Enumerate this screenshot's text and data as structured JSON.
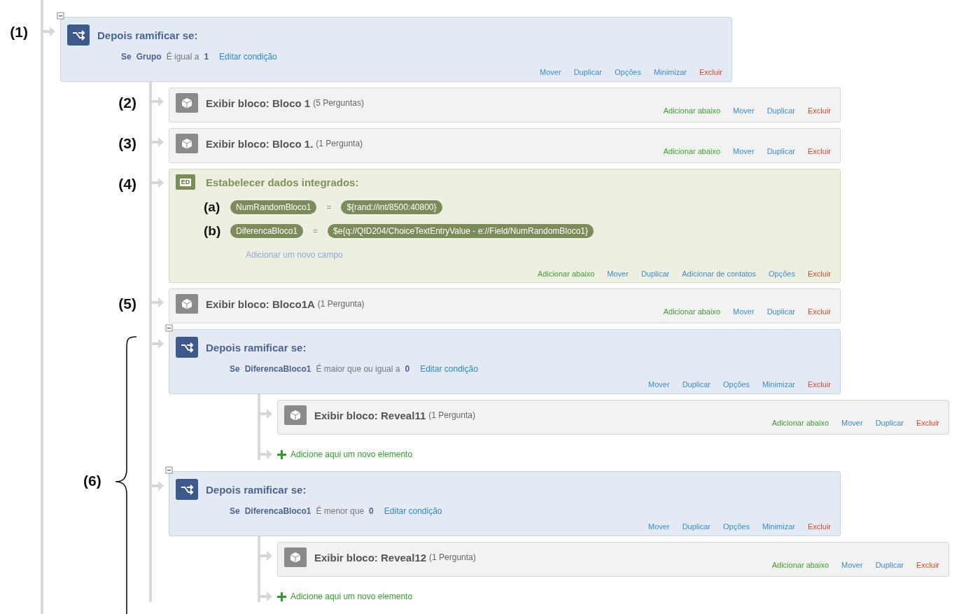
{
  "flow": [
    {
      "kind": "branch",
      "annotation": "(1)",
      "title": "Depois ramificar se:",
      "condition": {
        "prefix": "Se",
        "field": "Grupo",
        "operator": "É igual a",
        "value": "1",
        "edit": "Editar condição"
      },
      "actions": [
        {
          "label": "Mover",
          "kind": "link"
        },
        {
          "label": "Duplicar",
          "kind": "link"
        },
        {
          "label": "Opções",
          "kind": "link"
        },
        {
          "label": "Minimizar",
          "kind": "link"
        },
        {
          "label": "Excluir",
          "kind": "delete"
        }
      ],
      "children": [
        {
          "kind": "block",
          "annotation": "(2)",
          "title": "Exibir bloco: Bloco 1",
          "count": "(5 Perguntas)",
          "actions": [
            {
              "label": "Adicionar abaixo",
              "kind": "add"
            },
            {
              "label": "Mover",
              "kind": "link"
            },
            {
              "label": "Duplicar",
              "kind": "link"
            },
            {
              "label": "Excluir",
              "kind": "delete"
            }
          ]
        },
        {
          "kind": "block",
          "annotation": "(3)",
          "title": "Exibir bloco: Bloco 1.",
          "count": "(1 Pergunta)",
          "actions": [
            {
              "label": "Adicionar abaixo",
              "kind": "add"
            },
            {
              "label": "Mover",
              "kind": "link"
            },
            {
              "label": "Duplicar",
              "kind": "link"
            },
            {
              "label": "Excluir",
              "kind": "delete"
            }
          ]
        },
        {
          "kind": "embedded",
          "annotation": "(4)",
          "icon_label": "ED",
          "title": "Estabelecer dados integrados:",
          "fields": [
            {
              "annotation": "(a)",
              "name": "NumRandomBloco1",
              "equals": "=",
              "value": "${rand://int/8500:40800}"
            },
            {
              "annotation": "(b)",
              "name": "DiferencaBloco1",
              "equals": "=",
              "value": "$e{q://QID204/ChoiceTextEntryValue - e://Field/NumRandomBloco1}"
            }
          ],
          "add_field": "Adicionar um novo campo",
          "actions": [
            {
              "label": "Adicionar abaixo",
              "kind": "add"
            },
            {
              "label": "Mover",
              "kind": "link"
            },
            {
              "label": "Duplicar",
              "kind": "link"
            },
            {
              "label": "Adicionar de contatos",
              "kind": "link"
            },
            {
              "label": "Opções",
              "kind": "link"
            },
            {
              "label": "Excluir",
              "kind": "delete"
            }
          ]
        },
        {
          "kind": "block",
          "annotation": "(5)",
          "title": "Exibir bloco: Bloco1A",
          "count": "(1 Pergunta)",
          "actions": [
            {
              "label": "Adicionar abaixo",
              "kind": "add"
            },
            {
              "label": "Mover",
              "kind": "link"
            },
            {
              "label": "Duplicar",
              "kind": "link"
            },
            {
              "label": "Excluir",
              "kind": "delete"
            }
          ]
        },
        {
          "kind": "group",
          "annotation": "(6)",
          "children": [
            {
              "kind": "branch",
              "title": "Depois ramificar se:",
              "condition": {
                "prefix": "Se",
                "field": "DiferencaBloco1",
                "operator": "É maior que ou igual a",
                "value": "0",
                "edit": "Editar condição"
              },
              "actions": [
                {
                  "label": "Mover",
                  "kind": "link"
                },
                {
                  "label": "Duplicar",
                  "kind": "link"
                },
                {
                  "label": "Opções",
                  "kind": "link"
                },
                {
                  "label": "Minimizar",
                  "kind": "link"
                },
                {
                  "label": "Excluir",
                  "kind": "delete"
                }
              ],
              "children": [
                {
                  "kind": "block",
                  "title": "Exibir bloco: Reveal11",
                  "count": "(1 Pergunta)",
                  "actions": [
                    {
                      "label": "Adicionar abaixo",
                      "kind": "add"
                    },
                    {
                      "label": "Mover",
                      "kind": "link"
                    },
                    {
                      "label": "Duplicar",
                      "kind": "link"
                    },
                    {
                      "label": "Excluir",
                      "kind": "delete"
                    }
                  ]
                },
                {
                  "kind": "add",
                  "label": "Adicione aqui um novo elemento"
                }
              ]
            },
            {
              "kind": "branch",
              "title": "Depois ramificar se:",
              "condition": {
                "prefix": "Se",
                "field": "DiferencaBloco1",
                "operator": "É menor que",
                "value": "0",
                "edit": "Editar condição"
              },
              "actions": [
                {
                  "label": "Mover",
                  "kind": "link"
                },
                {
                  "label": "Duplicar",
                  "kind": "link"
                },
                {
                  "label": "Opções",
                  "kind": "link"
                },
                {
                  "label": "Minimizar",
                  "kind": "link"
                },
                {
                  "label": "Excluir",
                  "kind": "delete"
                }
              ],
              "children": [
                {
                  "kind": "block",
                  "title": "Exibir bloco: Reveal12",
                  "count": "(1 Pergunta)",
                  "actions": [
                    {
                      "label": "Adicionar abaixo",
                      "kind": "add"
                    },
                    {
                      "label": "Mover",
                      "kind": "link"
                    },
                    {
                      "label": "Duplicar",
                      "kind": "link"
                    },
                    {
                      "label": "Excluir",
                      "kind": "delete"
                    }
                  ]
                },
                {
                  "kind": "add",
                  "label": "Adicione aqui um novo elemento"
                }
              ]
            }
          ]
        }
      ]
    }
  ]
}
